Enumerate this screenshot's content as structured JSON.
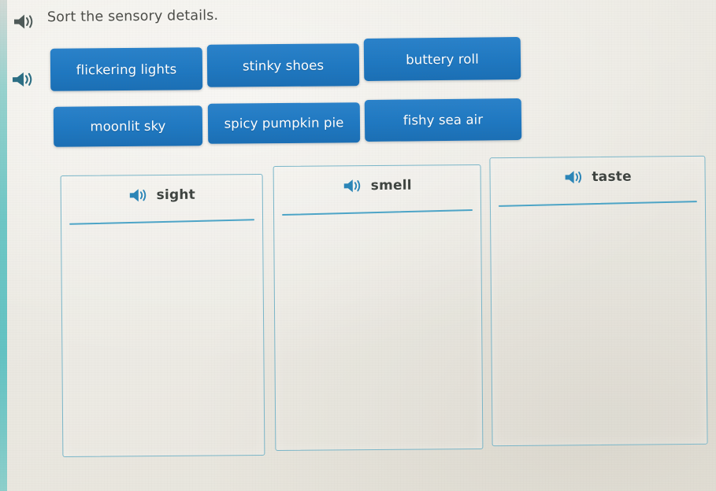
{
  "page": {
    "title": "Sort the sensory details.",
    "background_color": "#eeece6",
    "accent_blue": "#1f78c1",
    "zone_border_color": "#7ab6c9",
    "rule_color": "#3f9ec4",
    "left_strip_color": "#62c3c2"
  },
  "icons": {
    "title_speaker": "speaker-icon",
    "bank_speaker": "speaker-icon",
    "zone_speaker": "speaker-icon"
  },
  "word_bank": {
    "chips": [
      {
        "label": "flickering lights"
      },
      {
        "label": "stinky shoes"
      },
      {
        "label": "buttery roll"
      },
      {
        "label": "moonlit sky"
      },
      {
        "label": "spicy pumpkin pie"
      },
      {
        "label": "fishy sea air"
      }
    ]
  },
  "drop_zones": [
    {
      "label": "sight",
      "items": []
    },
    {
      "label": "smell",
      "items": []
    },
    {
      "label": "taste",
      "items": []
    }
  ]
}
